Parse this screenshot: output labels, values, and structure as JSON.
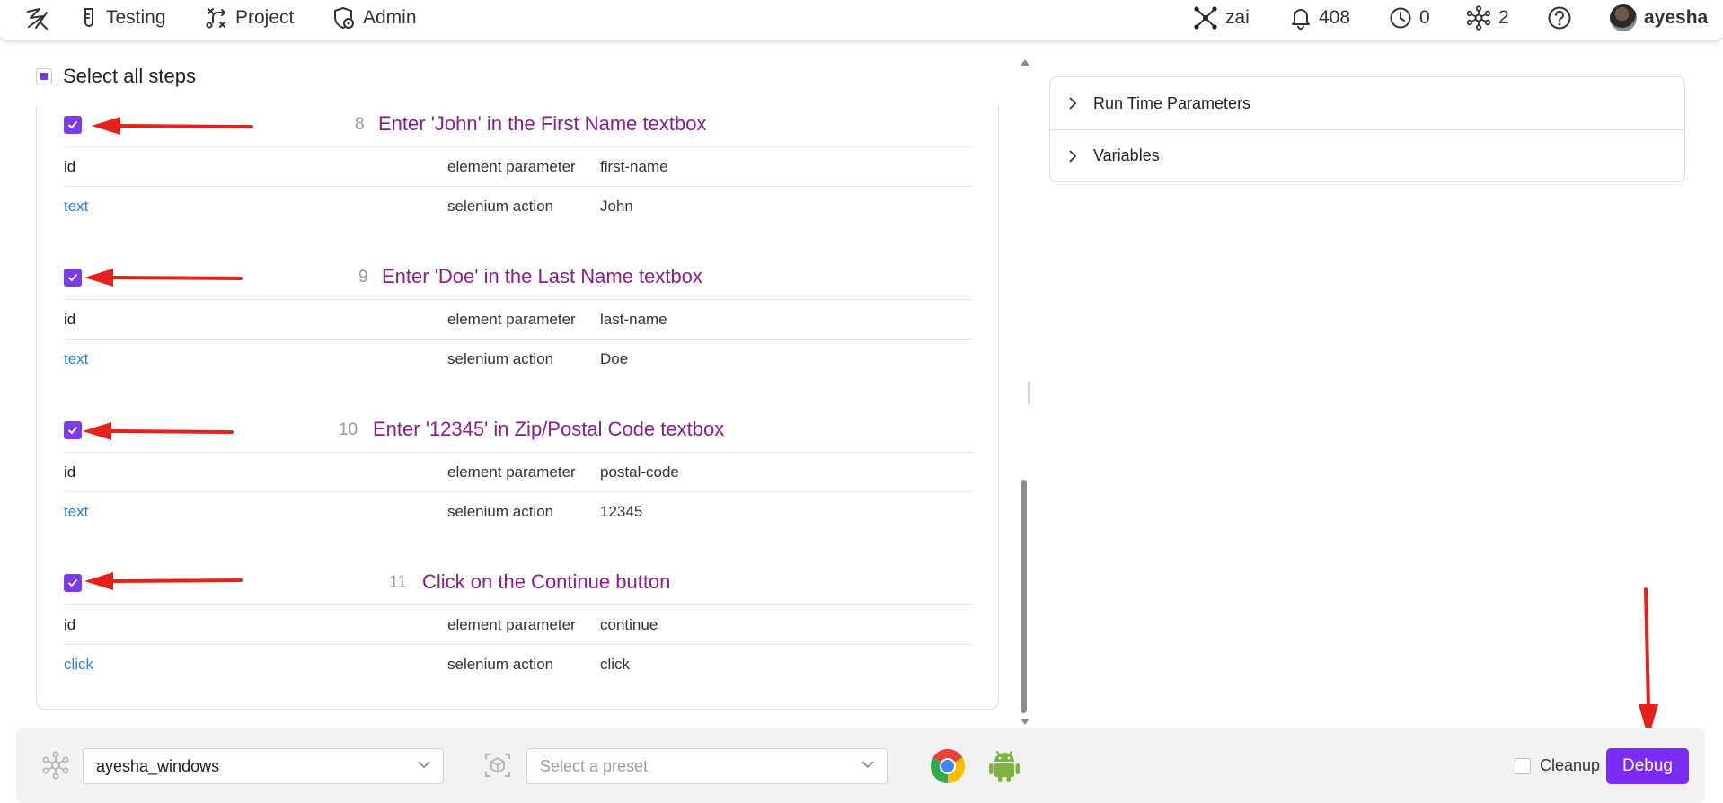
{
  "nav": {
    "testing": "Testing",
    "project": "Project",
    "admin": "Admin",
    "team": "zai",
    "notifications": "408",
    "history": "0",
    "nodes": "2",
    "user": "ayesha"
  },
  "steps_panel": {
    "select_all": "Select all steps",
    "steps": [
      {
        "number": "8",
        "title": "Enter 'John' in the First Name textbox",
        "checked": true,
        "rows": [
          {
            "c1": "id",
            "c2": "element parameter",
            "c3": "first-name"
          },
          {
            "c1": "text",
            "c2": "selenium action",
            "c3": "John"
          }
        ]
      },
      {
        "number": "9",
        "title": "Enter 'Doe' in the Last Name textbox",
        "checked": true,
        "rows": [
          {
            "c1": "id",
            "c2": "element parameter",
            "c3": "last-name"
          },
          {
            "c1": "text",
            "c2": "selenium action",
            "c3": "Doe"
          }
        ]
      },
      {
        "number": "10",
        "title": "Enter '12345' in Zip/Postal Code textbox",
        "checked": true,
        "rows": [
          {
            "c1": "id",
            "c2": "element parameter",
            "c3": "postal-code"
          },
          {
            "c1": "text",
            "c2": "selenium action",
            "c3": "12345"
          }
        ]
      },
      {
        "number": "11",
        "title": "Click on the Continue button",
        "checked": true,
        "rows": [
          {
            "c1": "id",
            "c2": "element parameter",
            "c3": "continue"
          },
          {
            "c1": "click",
            "c2": "selenium action",
            "c3": "click"
          }
        ]
      }
    ]
  },
  "right_panel": {
    "accordion": [
      "Run Time Parameters",
      "Variables"
    ]
  },
  "bottom_bar": {
    "node_value": "ayesha_windows",
    "preset_placeholder": "Select a preset",
    "cleanup_label": "Cleanup",
    "debug_label": "Debug"
  },
  "colors": {
    "accent": "#7c3aed",
    "step_title": "#8b1b8f",
    "link": "#2f7fd6",
    "annotation": "#e8201a"
  }
}
